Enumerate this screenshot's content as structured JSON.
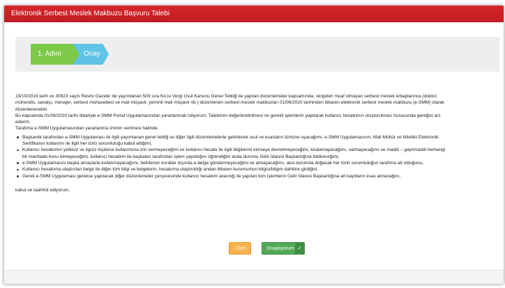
{
  "header": {
    "title": "Elektronik Serbest Meslek Makbuzu Başvuru Talebi",
    "bg_color": "#d0222a"
  },
  "steps": [
    {
      "label": "1. Adım",
      "color": "#7ec84a",
      "state": "active"
    },
    {
      "label": "Onay",
      "color": "#5fc4e5",
      "state": "pending"
    }
  ],
  "content": {
    "paragraph_1": [
      "19/10/2019 tarih ve 30923 sayılı Resmi Gazete' de yayımlanan 509 sıra No.lu Vergi Usul Kanunu Genel Tebliği ile yapılan düzenlemeler kapsamında, vergiden muaf olmayan serbest meslek erbaplarınca (doktor,",
      "mühendis, sanatçı, menajer, serbest muhasebeci ve mali müşavir, yeminli mali müşavir vb.) düzenlenen serbest meslek makbuzları 01/06/2020 tarihinden itibaren elektronik serbest meslek makbuzu (e-SMM) olarak",
      "düzenlenecektir."
    ],
    "paragraph_2": [
      "Bu kapsamda 01/06/2020 tarihi itibariyle e-SMM Portal Uygulamasından yararlanmak istiyorum. Talebimin değerlendirilmesi ve gerekli işlemlerin yapılarak kullanıcı hesabımın oluşturulması hususunda gereğini arz",
      "ederim."
    ],
    "paragraph_3": "Tarafıma e-SMM Uygulamasından yararlanma izninin verilmesi halinde;",
    "bullets": [
      {
        "line_1": "Başkanlık tarafından e-SMM Uygulaması ile ilgili yayımlanan genel tebliğ ve diğer ilgili düzenlemelerle getirilecek usul ve esasların tümüne uyacağımı, e-SMM Uygulamasının, Mali Mühür ve Nitelikli Elektronik",
        "line_2": "Sertifikanın kullanımı ile ilgili her türlü sorumluluğu kabul ettiğimi,"
      },
      {
        "line_1": "Kullanıcı hesabımın yetkisiz ve ilgisiz kişilerce kullanımına izin vermeyeceğimi ve kullanıcı hesabı ile ilgili bilgilerimi kimseye devretmeyeceğimi, kiralamayacağımı, satmayacağımı ve maddi – gayrimaddi herhangi",
        "line_2": "bir menfaate konu etmeyeceğimi, kullanıcı hesabım ile başkaları tarafından işlem yapıldığını öğrendiğim anda durumu Gelir İdaresi Başkanlığına bildireceğimi,"
      },
      {
        "line_1": "e-SMM Uygulamasını başka amaçlarla kullanmayacağımı, belirlenen kurallar dışında e-belge göndermeyeceğimi ve almayacağımı, aksi durumda doğacak her türlü sorumluluğun tarafıma ait olduğunu,",
        "line_2": ""
      },
      {
        "line_1": "Kullanıcı hesabıma ulaştırılan belge ile diğer tüm bilgi ve belgelerin, hesabıma ulaştırıldığı andan itibaren kurumumun bilgisi/bilgim dahiline girdiğini,",
        "line_2": ""
      },
      {
        "line_1": "Gerek e-SMM Uygulaması gerekse yapılacak diğer düzenlemeler çerçevesinde kullanıcı hesabım aracılığı ile yapılan tüm işlemlerin Gelir İdaresi Başkanlığına ait kayıtların esas alınacağını,",
        "line_2": ""
      }
    ],
    "closing": "kabul ve taahhüt ediyorum."
  },
  "buttons": {
    "back_label": "Geri",
    "back_icon": "chevron-left-icon",
    "back_color": "#f7b24e",
    "confirm_label": "Onaylıyorum",
    "confirm_icon": "check-icon",
    "confirm_color": "#52a857"
  }
}
